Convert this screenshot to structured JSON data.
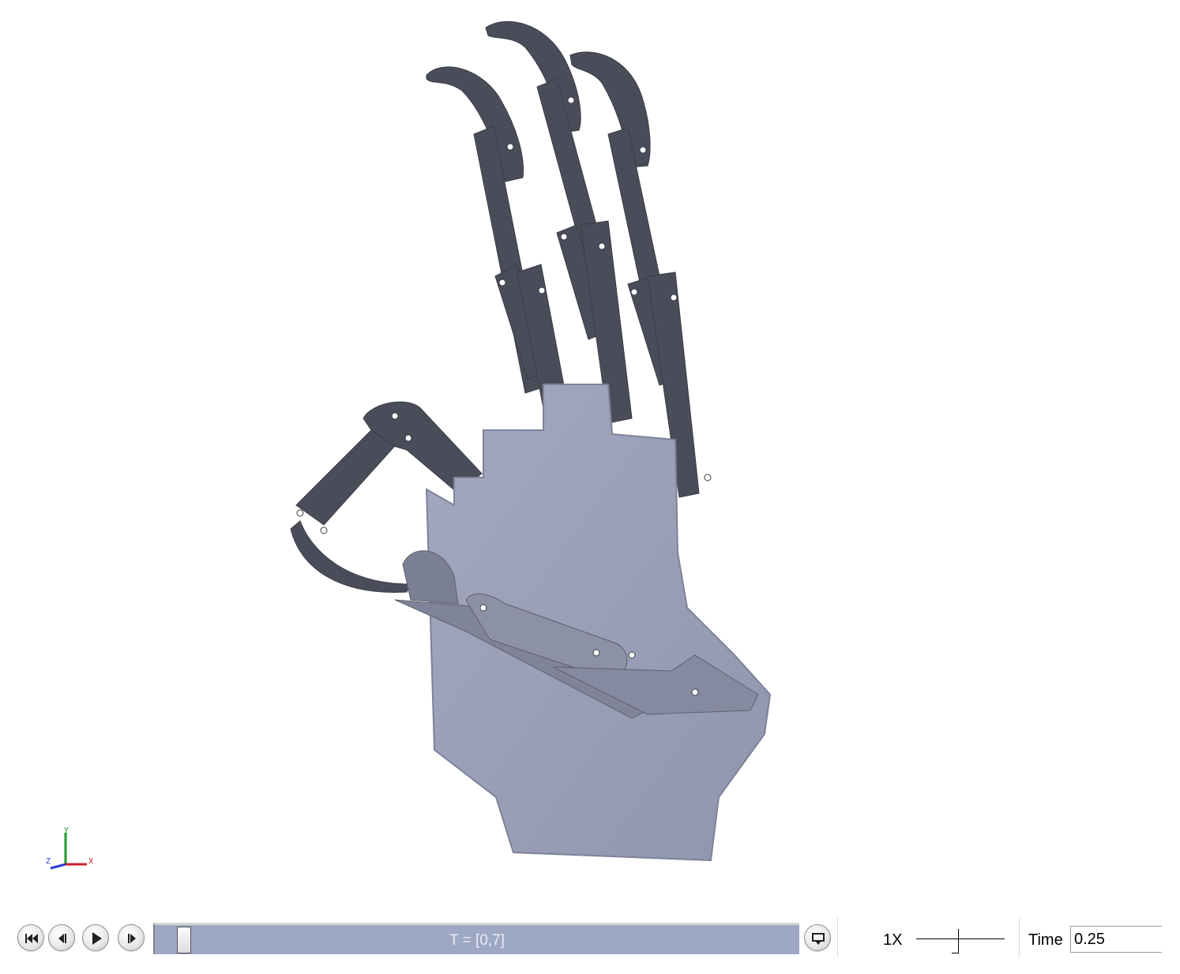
{
  "viewport": {
    "model_description": "3D CAD model of a robotic hand with four fingers, rendered in blue-grey",
    "part_color": "#9aa0b8",
    "part_dark_color": "#4b4e5a",
    "background": "#ffffff"
  },
  "triad": {
    "x_label": "X",
    "y_label": "Y",
    "z_label": "Z",
    "x_color": "#d0202a",
    "y_color": "#1f9a2b",
    "z_color": "#2a3fd0"
  },
  "toolbar": {
    "buttons": [
      {
        "name": "rewind",
        "icon": "rewind-to-start-icon"
      },
      {
        "name": "step-back",
        "icon": "step-back-icon"
      },
      {
        "name": "play",
        "icon": "play-icon"
      },
      {
        "name": "step-forward",
        "icon": "step-forward-icon"
      }
    ],
    "timeline_label": "T = [0,7]",
    "timeline_color": "#9ea8c4",
    "playback_mode_icon": "playback-mode-icon",
    "speed_label": "1X",
    "time_label": "Time",
    "time_value": "0.25"
  }
}
